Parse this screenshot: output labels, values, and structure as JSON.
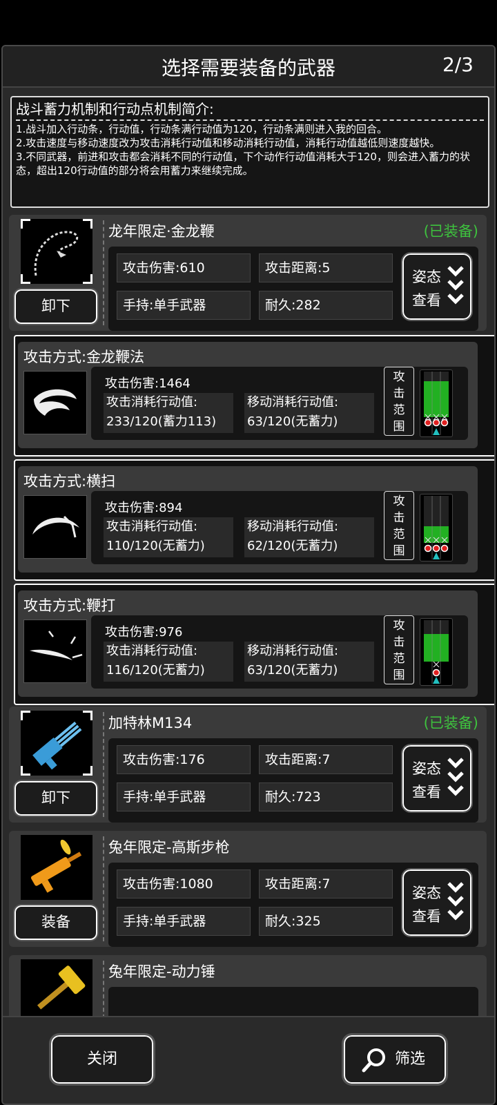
{
  "header": {
    "title": "选择需要装备的武器",
    "page": "2/3"
  },
  "intro": {
    "title": "战斗蓄力机制和行动点机制简介:",
    "lines": [
      "1.战斗加入行动条，行动值，行动条满行动值为120，行动条满则进入我的回合。",
      "2.攻击速度与移动速度改为攻击消耗行动值和移动消耗行动值，消耗行动值越低则速度越快。",
      "3.不同武器，前进和攻击都会消耗不同的行动值，下个动作行动值消耗大于120，则会进入蓄力的状态，超出120行动值的部分将会用蓄力来继续完成。"
    ]
  },
  "weapons": [
    {
      "name": "龙年限定·金龙鞭",
      "status": "(已装备)",
      "button": "卸下",
      "damage": "攻击伤害:610",
      "range": "攻击距离:5",
      "hold": "手持:单手武器",
      "durability": "耐久:282",
      "posture": [
        "姿态",
        "查看"
      ],
      "icon": "golden-dragon-whip-icon"
    },
    {
      "name": "加特林M134",
      "status": "(已装备)",
      "button": "卸下",
      "damage": "攻击伤害:176",
      "range": "攻击距离:7",
      "hold": "手持:单手武器",
      "durability": "耐久:723",
      "posture": [
        "姿态",
        "查看"
      ],
      "icon": "gatling-gun-icon"
    },
    {
      "name": "兔年限定-高斯步枪",
      "status": "",
      "button": "装备",
      "damage": "攻击伤害:1080",
      "range": "攻击距离:7",
      "hold": "手持:单手武器",
      "durability": "耐久:325",
      "posture": [
        "姿态",
        "查看"
      ],
      "icon": "gauss-rifle-icon"
    },
    {
      "name": "兔年限定-动力锤",
      "status": "",
      "icon": "power-hammer-icon"
    }
  ],
  "attacks": [
    {
      "name": "攻击方式:金龙鞭法",
      "damage": "攻击伤害:1464",
      "cost_label": "攻击消耗行动值:",
      "cost": "233/120(蓄力113)",
      "move_label": "移动消耗行动值:",
      "move": "63/120(无蓄力)",
      "range_label": [
        "攻",
        "击",
        "范",
        "围"
      ],
      "icon": "whirl-slash-icon"
    },
    {
      "name": "攻击方式:横扫",
      "damage": "攻击伤害:894",
      "cost_label": "攻击消耗行动值:",
      "cost": "110/120(无蓄力)",
      "move_label": "移动消耗行动值:",
      "move": "62/120(无蓄力)",
      "range_label": [
        "攻",
        "击",
        "范",
        "围"
      ],
      "icon": "sweep-slash-icon"
    },
    {
      "name": "攻击方式:鞭打",
      "damage": "攻击伤害:976",
      "cost_label": "攻击消耗行动值:",
      "cost": "116/120(无蓄力)",
      "move_label": "移动消耗行动值:",
      "move": "63/120(无蓄力)",
      "range_label": [
        "攻",
        "击",
        "范",
        "围"
      ],
      "icon": "lash-strike-icon"
    }
  ],
  "footer": {
    "close": "关闭",
    "filter": "筛选"
  },
  "colors": {
    "equipped": "#3ec23e",
    "range_fill": "#22b022",
    "target_red": "#e02020",
    "player_cyan": "#22c0c0"
  }
}
